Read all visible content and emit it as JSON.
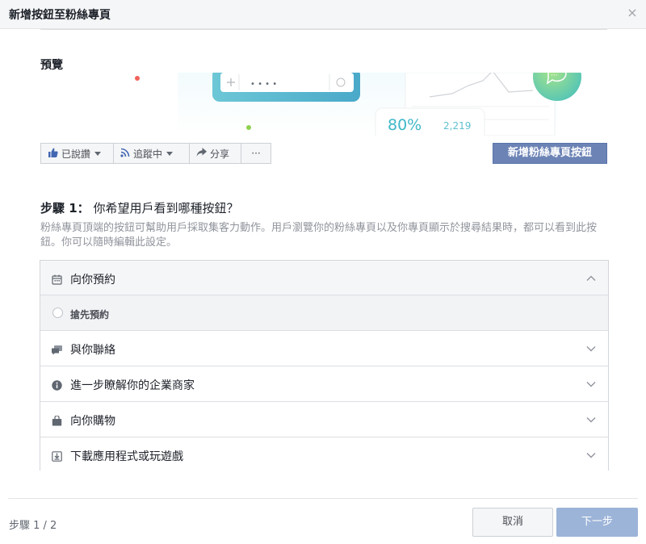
{
  "dialog": {
    "title": "新增按鈕至粉絲專頁",
    "close_label": "×"
  },
  "preview": {
    "label": "預覽",
    "search_placeholder": "• • • •",
    "stat_percent": "80%",
    "stat_count": "2,219",
    "chat_dots": "···"
  },
  "toolbar": {
    "liked_label": "已說讚",
    "following_label": "追蹤中",
    "share_label": "分享",
    "more_label": "···",
    "add_button_label": "新增粉絲專頁按鈕"
  },
  "step": {
    "prefix": "步驟 1：",
    "question": "你希望用戶看到哪種按鈕？",
    "description": "粉絲專頁頂端的按鈕可幫助用戶採取集客力動作。用戶瀏覽你的粉絲專頁以及你專頁顯示於搜尋結果時，都可以看到此按鈕。你可以隨時編輯此設定。"
  },
  "options": [
    {
      "label": "向你預約",
      "icon": "calendar-icon",
      "expanded": true,
      "sub_options": [
        {
          "label": "搶先預約",
          "selected": false
        }
      ]
    },
    {
      "label": "與你聯絡",
      "icon": "chat-bubbles-icon",
      "expanded": false
    },
    {
      "label": "進一步瞭解你的企業商家",
      "icon": "info-icon",
      "expanded": false
    },
    {
      "label": "向你購物",
      "icon": "shopping-bag-icon",
      "expanded": false
    },
    {
      "label": "下載應用程式或玩遊戲",
      "icon": "download-icon",
      "expanded": false
    }
  ],
  "footer": {
    "step_count": "步驟 1 / 2",
    "cancel_label": "取消",
    "next_label": "下一步"
  },
  "colors": {
    "primary": "#4267b2",
    "add_button": "#6c83b5",
    "next_disabled": "#9cb4d8",
    "stat_teal": "#3fb7c8"
  }
}
